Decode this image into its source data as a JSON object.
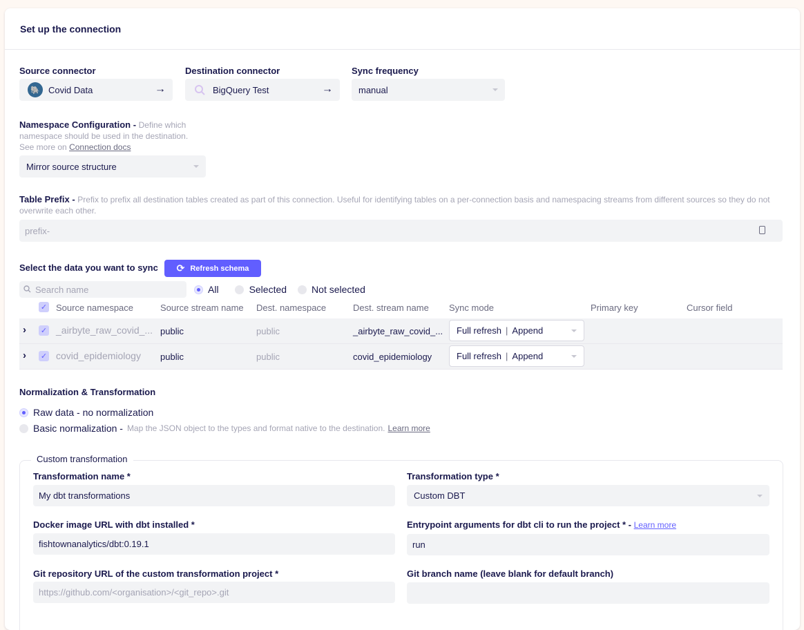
{
  "header": {
    "title": "Set up the connection"
  },
  "source": {
    "label": "Source connector",
    "name": "Covid Data",
    "arrow": "→"
  },
  "destination": {
    "label": "Destination connector",
    "name": "BigQuery Test",
    "arrow": "→"
  },
  "sync": {
    "label": "Sync frequency",
    "value": "manual"
  },
  "namespace": {
    "label": "Namespace Configuration - ",
    "desc1": "Define which",
    "desc2": "namespace should be used in the destination.",
    "desc3": "See more on",
    "link": "Connection docs",
    "value": "Mirror source structure"
  },
  "prefix": {
    "label": "Table Prefix - ",
    "desc1": "Prefix to prefix all destination tables created as part of this connection. Useful for identifying tables on a per-connection basis and namespacing streams from different sources so they do",
    "desc2": "not overwrite each other.",
    "placeholder": "prefix-"
  },
  "streams": {
    "title": "Select the data you want to sync",
    "refresh_label": "Refresh schema",
    "search_placeholder": "Search name",
    "filters": [
      "All",
      "Selected",
      "Not selected"
    ],
    "columns": [
      "Source namespace",
      "Source stream name",
      "Dest. namespace",
      "Dest. stream name",
      "Sync mode",
      "Primary key",
      "Cursor field"
    ],
    "rows": [
      {
        "source_namespace": "_airbyte_raw_covid_...",
        "source_stream": "public",
        "dest_namespace": "public",
        "dest_stream": "_airbyte_raw_covid_...",
        "sync_mode_a": "Full refresh",
        "sync_mode_b": "Append"
      },
      {
        "source_namespace": "covid_epidemiology",
        "source_stream": "public",
        "dest_namespace": "public",
        "dest_stream": "covid_epidemiology",
        "sync_mode_a": "Full refresh",
        "sync_mode_b": "Append"
      }
    ]
  },
  "normalization": {
    "title": "Normalization & Transformation",
    "raw_label": "Raw data - no normalization",
    "basic_label": "Basic normalization - ",
    "basic_desc": "Map the JSON object to the types and format native to the destination.",
    "learn_more": "Learn more"
  },
  "custom": {
    "legend": "Custom transformation",
    "name_label": "Transformation name *",
    "name_value": "My dbt transformations",
    "type_label": "Transformation type *",
    "type_value": "Custom DBT",
    "docker_label": "Docker image URL with dbt installed *",
    "docker_value": "fishtownanalytics/dbt:0.19.1",
    "entry_label": "Entrypoint arguments for dbt cli to run the project * - ",
    "entry_link": "Learn more",
    "entry_value": "run",
    "git_label": "Git repository URL of the custom transformation project *",
    "git_placeholder": "https://github.com/<organisation>/<git_repo>.git",
    "branch_label": "Git branch name (leave blank for default branch)"
  },
  "colors": {
    "accent": "#615eff",
    "text": "#1a194d",
    "muted": "#a5a5b5",
    "field": "#f2f3f5"
  }
}
